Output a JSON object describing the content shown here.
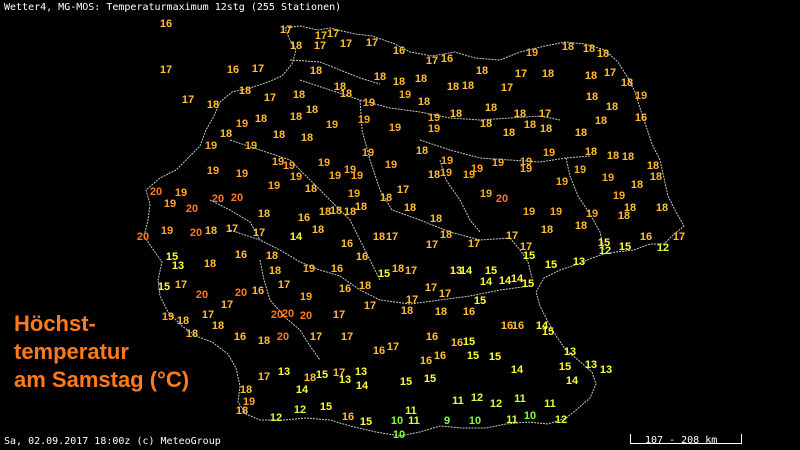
{
  "header": {
    "text": "Wetter4, MG-MOS: Temperaturmaximum 12stg (255 Stationen)"
  },
  "footer": {
    "text": "Sa, 02.09.2017 18:00z (c) MeteoGroup"
  },
  "title": {
    "line1": "Höchst-",
    "line2": "temperatur",
    "line3": "am Samstag (°C)"
  },
  "scale": {
    "label": "107 - 208 km"
  },
  "colors": {
    "background": "#000000",
    "border": "#c8c8c8",
    "title": "#ff7a1a",
    "t9_10": "#7cff3c",
    "t11_12": "#d8ff3c",
    "t13_15": "#ffff33",
    "t16_18": "#ffbf33",
    "t19": "#ffaa22",
    "t20_21": "#ff7a1a"
  },
  "stations": [
    [
      166,
      23,
      "16"
    ],
    [
      286,
      29,
      "17"
    ],
    [
      321,
      35,
      "17"
    ],
    [
      333,
      33,
      "17"
    ],
    [
      296,
      45,
      "18"
    ],
    [
      320,
      45,
      "17"
    ],
    [
      346,
      43,
      "17"
    ],
    [
      372,
      42,
      "17"
    ],
    [
      399,
      50,
      "16"
    ],
    [
      432,
      60,
      "17"
    ],
    [
      447,
      58,
      "16"
    ],
    [
      532,
      52,
      "19"
    ],
    [
      568,
      46,
      "18"
    ],
    [
      589,
      48,
      "18"
    ],
    [
      603,
      53,
      "18"
    ],
    [
      166,
      69,
      "17"
    ],
    [
      233,
      69,
      "16"
    ],
    [
      258,
      68,
      "17"
    ],
    [
      316,
      70,
      "18"
    ],
    [
      380,
      76,
      "18"
    ],
    [
      399,
      81,
      "18"
    ],
    [
      421,
      78,
      "18"
    ],
    [
      482,
      70,
      "18"
    ],
    [
      521,
      73,
      "17"
    ],
    [
      548,
      73,
      "18"
    ],
    [
      591,
      75,
      "18"
    ],
    [
      610,
      72,
      "17"
    ],
    [
      627,
      82,
      "18"
    ],
    [
      188,
      99,
      "17"
    ],
    [
      213,
      104,
      "18"
    ],
    [
      245,
      90,
      "18"
    ],
    [
      270,
      97,
      "17"
    ],
    [
      299,
      94,
      "18"
    ],
    [
      340,
      86,
      "18"
    ],
    [
      346,
      93,
      "18"
    ],
    [
      369,
      102,
      "19"
    ],
    [
      405,
      94,
      "19"
    ],
    [
      424,
      101,
      "18"
    ],
    [
      453,
      86,
      "18"
    ],
    [
      468,
      85,
      "18"
    ],
    [
      507,
      87,
      "17"
    ],
    [
      592,
      96,
      "18"
    ],
    [
      612,
      106,
      "18"
    ],
    [
      641,
      95,
      "19"
    ],
    [
      641,
      117,
      "16"
    ],
    [
      226,
      133,
      "18"
    ],
    [
      242,
      123,
      "19"
    ],
    [
      261,
      118,
      "18"
    ],
    [
      279,
      134,
      "18"
    ],
    [
      312,
      109,
      "18"
    ],
    [
      296,
      116,
      "18"
    ],
    [
      332,
      124,
      "19"
    ],
    [
      364,
      119,
      "19"
    ],
    [
      395,
      127,
      "19"
    ],
    [
      434,
      117,
      "19"
    ],
    [
      434,
      128,
      "19"
    ],
    [
      456,
      113,
      "18"
    ],
    [
      491,
      107,
      "18"
    ],
    [
      486,
      123,
      "18"
    ],
    [
      509,
      132,
      "18"
    ],
    [
      520,
      113,
      "18"
    ],
    [
      545,
      113,
      "17"
    ],
    [
      546,
      128,
      "18"
    ],
    [
      530,
      124,
      "18"
    ],
    [
      581,
      132,
      "18"
    ],
    [
      601,
      120,
      "18"
    ],
    [
      211,
      145,
      "19"
    ],
    [
      251,
      145,
      "19"
    ],
    [
      307,
      137,
      "18"
    ],
    [
      213,
      170,
      "19"
    ],
    [
      242,
      173,
      "19"
    ],
    [
      278,
      161,
      "19"
    ],
    [
      289,
      165,
      "19"
    ],
    [
      296,
      176,
      "19"
    ],
    [
      274,
      185,
      "19"
    ],
    [
      311,
      188,
      "18"
    ],
    [
      324,
      162,
      "19"
    ],
    [
      335,
      175,
      "19"
    ],
    [
      350,
      169,
      "19"
    ],
    [
      357,
      175,
      "19"
    ],
    [
      368,
      152,
      "19"
    ],
    [
      391,
      164,
      "19"
    ],
    [
      422,
      150,
      "18"
    ],
    [
      447,
      160,
      "19"
    ],
    [
      434,
      174,
      "18"
    ],
    [
      446,
      172,
      "19"
    ],
    [
      469,
      174,
      "19"
    ],
    [
      477,
      168,
      "19"
    ],
    [
      498,
      162,
      "19"
    ],
    [
      526,
      161,
      "19"
    ],
    [
      526,
      168,
      "19"
    ],
    [
      549,
      152,
      "19"
    ],
    [
      562,
      181,
      "19"
    ],
    [
      580,
      169,
      "19"
    ],
    [
      591,
      151,
      "18"
    ],
    [
      613,
      155,
      "18"
    ],
    [
      628,
      156,
      "18"
    ],
    [
      653,
      165,
      "18"
    ],
    [
      656,
      176,
      "18"
    ],
    [
      608,
      177,
      "19"
    ],
    [
      156,
      191,
      "20"
    ],
    [
      181,
      192,
      "19"
    ],
    [
      170,
      203,
      "19"
    ],
    [
      192,
      208,
      "20"
    ],
    [
      218,
      198,
      "20"
    ],
    [
      237,
      197,
      "20"
    ],
    [
      264,
      213,
      "18"
    ],
    [
      304,
      217,
      "16"
    ],
    [
      325,
      211,
      "18"
    ],
    [
      336,
      210,
      "18"
    ],
    [
      354,
      193,
      "19"
    ],
    [
      350,
      211,
      "18"
    ],
    [
      361,
      206,
      "18"
    ],
    [
      386,
      197,
      "18"
    ],
    [
      403,
      189,
      "17"
    ],
    [
      410,
      207,
      "18"
    ],
    [
      436,
      218,
      "18"
    ],
    [
      486,
      193,
      "19"
    ],
    [
      502,
      198,
      "20"
    ],
    [
      529,
      211,
      "19"
    ],
    [
      556,
      211,
      "19"
    ],
    [
      592,
      213,
      "19"
    ],
    [
      619,
      195,
      "19"
    ],
    [
      637,
      184,
      "18"
    ],
    [
      630,
      207,
      "18"
    ],
    [
      662,
      207,
      "18"
    ],
    [
      143,
      236,
      "20"
    ],
    [
      167,
      230,
      "19"
    ],
    [
      196,
      232,
      "20"
    ],
    [
      211,
      230,
      "18"
    ],
    [
      232,
      228,
      "17"
    ],
    [
      259,
      232,
      "17"
    ],
    [
      296,
      236,
      "14"
    ],
    [
      318,
      229,
      "18"
    ],
    [
      347,
      243,
      "16"
    ],
    [
      379,
      236,
      "18"
    ],
    [
      392,
      236,
      "17"
    ],
    [
      432,
      244,
      "17"
    ],
    [
      446,
      234,
      "18"
    ],
    [
      474,
      243,
      "17"
    ],
    [
      512,
      235,
      "17"
    ],
    [
      526,
      246,
      "17"
    ],
    [
      547,
      229,
      "18"
    ],
    [
      581,
      225,
      "18"
    ],
    [
      604,
      242,
      "15"
    ],
    [
      624,
      215,
      "18"
    ],
    [
      605,
      250,
      "12"
    ],
    [
      625,
      246,
      "15"
    ],
    [
      646,
      236,
      "16"
    ],
    [
      679,
      236,
      "17"
    ],
    [
      663,
      247,
      "12"
    ],
    [
      172,
      256,
      "15"
    ],
    [
      178,
      265,
      "13"
    ],
    [
      210,
      263,
      "18"
    ],
    [
      241,
      254,
      "16"
    ],
    [
      272,
      255,
      "18"
    ],
    [
      275,
      270,
      "18"
    ],
    [
      309,
      268,
      "19"
    ],
    [
      337,
      268,
      "16"
    ],
    [
      362,
      256,
      "16"
    ],
    [
      384,
      273,
      "15"
    ],
    [
      398,
      268,
      "18"
    ],
    [
      411,
      270,
      "17"
    ],
    [
      456,
      270,
      "13"
    ],
    [
      466,
      270,
      "14"
    ],
    [
      491,
      270,
      "15"
    ],
    [
      529,
      255,
      "15"
    ],
    [
      528,
      283,
      "15"
    ],
    [
      551,
      264,
      "15"
    ],
    [
      579,
      261,
      "13"
    ],
    [
      164,
      286,
      "15"
    ],
    [
      181,
      284,
      "17"
    ],
    [
      202,
      294,
      "20"
    ],
    [
      227,
      304,
      "17"
    ],
    [
      241,
      292,
      "20"
    ],
    [
      258,
      290,
      "16"
    ],
    [
      284,
      284,
      "17"
    ],
    [
      345,
      288,
      "16"
    ],
    [
      365,
      285,
      "18"
    ],
    [
      431,
      287,
      "17"
    ],
    [
      445,
      293,
      "17"
    ],
    [
      486,
      281,
      "14"
    ],
    [
      505,
      280,
      "14"
    ],
    [
      517,
      278,
      "14"
    ],
    [
      168,
      316,
      "19"
    ],
    [
      183,
      320,
      "18"
    ],
    [
      208,
      314,
      "17"
    ],
    [
      218,
      325,
      "18"
    ],
    [
      192,
      333,
      "18"
    ],
    [
      277,
      314,
      "20"
    ],
    [
      288,
      313,
      "20"
    ],
    [
      306,
      296,
      "19"
    ],
    [
      306,
      315,
      "20"
    ],
    [
      339,
      314,
      "17"
    ],
    [
      370,
      305,
      "17"
    ],
    [
      407,
      310,
      "18"
    ],
    [
      412,
      299,
      "17"
    ],
    [
      480,
      300,
      "15"
    ],
    [
      441,
      311,
      "18"
    ],
    [
      469,
      311,
      "16"
    ],
    [
      507,
      325,
      "16"
    ],
    [
      518,
      325,
      "16"
    ],
    [
      542,
      325,
      "14"
    ],
    [
      548,
      331,
      "15"
    ],
    [
      240,
      336,
      "16"
    ],
    [
      264,
      340,
      "18"
    ],
    [
      283,
      336,
      "20"
    ],
    [
      316,
      336,
      "17"
    ],
    [
      347,
      336,
      "17"
    ],
    [
      393,
      346,
      "17"
    ],
    [
      379,
      350,
      "16"
    ],
    [
      432,
      336,
      "16"
    ],
    [
      457,
      342,
      "16"
    ],
    [
      469,
      341,
      "15"
    ],
    [
      440,
      355,
      "16"
    ],
    [
      426,
      360,
      "16"
    ],
    [
      495,
      356,
      "15"
    ],
    [
      473,
      355,
      "15"
    ],
    [
      570,
      351,
      "13"
    ],
    [
      565,
      366,
      "15"
    ],
    [
      591,
      364,
      "13"
    ],
    [
      606,
      369,
      "13"
    ],
    [
      264,
      376,
      "17"
    ],
    [
      284,
      371,
      "13"
    ],
    [
      310,
      377,
      "18"
    ],
    [
      322,
      374,
      "15"
    ],
    [
      339,
      372,
      "17"
    ],
    [
      361,
      371,
      "13"
    ],
    [
      345,
      379,
      "13"
    ],
    [
      362,
      385,
      "14"
    ],
    [
      406,
      381,
      "15"
    ],
    [
      430,
      378,
      "15"
    ],
    [
      517,
      369,
      "14"
    ],
    [
      572,
      380,
      "14"
    ],
    [
      246,
      389,
      "18"
    ],
    [
      249,
      401,
      "19"
    ],
    [
      302,
      389,
      "14"
    ],
    [
      242,
      410,
      "18"
    ],
    [
      276,
      417,
      "12"
    ],
    [
      300,
      409,
      "12"
    ],
    [
      326,
      406,
      "15"
    ],
    [
      348,
      416,
      "16"
    ],
    [
      366,
      421,
      "15"
    ],
    [
      397,
      420,
      "10"
    ],
    [
      411,
      410,
      "11"
    ],
    [
      414,
      420,
      "11"
    ],
    [
      447,
      420,
      "9"
    ],
    [
      475,
      420,
      "10"
    ],
    [
      458,
      400,
      "11"
    ],
    [
      477,
      397,
      "12"
    ],
    [
      496,
      403,
      "12"
    ],
    [
      520,
      398,
      "11"
    ],
    [
      512,
      419,
      "11"
    ],
    [
      530,
      415,
      "10"
    ],
    [
      550,
      403,
      "11"
    ],
    [
      561,
      419,
      "12"
    ],
    [
      399,
      434,
      "10"
    ]
  ]
}
